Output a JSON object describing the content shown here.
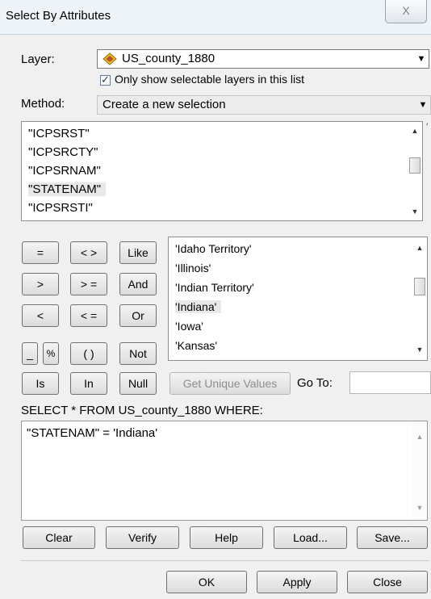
{
  "window": {
    "title": "Select By Attributes",
    "close_glyph": "X"
  },
  "layer": {
    "label": "Layer:",
    "value": "US_county_1880",
    "icon": "layer-icon",
    "only_selectable": "Only show selectable layers in this list",
    "only_selectable_checked": true
  },
  "method": {
    "label": "Method:",
    "value": "Create a new selection"
  },
  "fields": [
    "\"ICPSRST\"",
    "\"ICPSRCTY\"",
    "\"ICPSRNAM\"",
    "\"STATENAM\"",
    "\"ICPSRSTI\""
  ],
  "fields_selected_index": 3,
  "operators": {
    "eq": "=",
    "ne": "< >",
    "like": "Like",
    "gt": ">",
    "ge": "> =",
    "and": "And",
    "lt": "<",
    "le": "< =",
    "or": "Or",
    "underscore": "_",
    "percent": "%",
    "parens": "( )",
    "not": "Not",
    "is": "Is",
    "in": "In",
    "null": "Null"
  },
  "values": [
    "'Idaho Territory'",
    "'Illinois'",
    "'Indian Territory'",
    "'Indiana'",
    "'Iowa'",
    "'Kansas'"
  ],
  "values_selected_index": 3,
  "unique": {
    "button": "Get Unique Values",
    "goto_label": "Go To:",
    "goto_value": ""
  },
  "sql": {
    "prefix": "SELECT * FROM US_county_1880 WHERE:",
    "expression": "\"STATENAM\" = 'Indiana'"
  },
  "actions": {
    "clear": "Clear",
    "verify": "Verify",
    "help": "Help",
    "load": "Load...",
    "save": "Save..."
  },
  "footer": {
    "ok": "OK",
    "apply": "Apply",
    "close": "Close"
  }
}
